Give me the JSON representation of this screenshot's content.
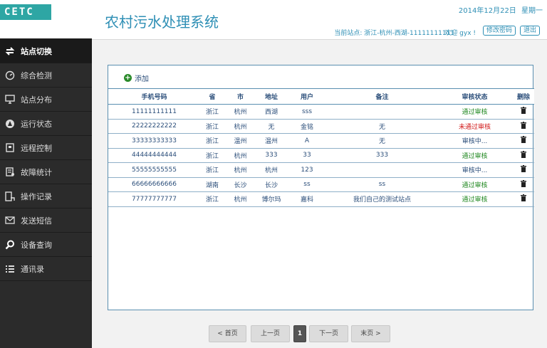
{
  "app": {
    "logo": "CETC",
    "title": "农村污水处理系统",
    "date": "2014年12月22日",
    "weekday": "星期一",
    "current_station": "当前站点: 浙江-杭州-西湖-11111111111",
    "welcome": "欢迎 gyx !",
    "change_password": "修改密码",
    "logout": "退出"
  },
  "sidebar": {
    "items": [
      {
        "label": "站点切换",
        "icon": "swap-icon"
      },
      {
        "label": "综合检测",
        "icon": "gauge-icon"
      },
      {
        "label": "站点分布",
        "icon": "monitor-icon"
      },
      {
        "label": "运行状态",
        "icon": "user-circle-icon"
      },
      {
        "label": "远程控制",
        "icon": "remote-icon"
      },
      {
        "label": "故障统计",
        "icon": "report-icon"
      },
      {
        "label": "操作记录",
        "icon": "record-icon"
      },
      {
        "label": "发送短信",
        "icon": "mail-icon"
      },
      {
        "label": "设备查询",
        "icon": "search-icon"
      },
      {
        "label": "通讯录",
        "icon": "list-icon"
      }
    ]
  },
  "toolbar": {
    "add_label": "添加"
  },
  "table": {
    "headers": [
      "手机号码",
      "省",
      "市",
      "地址",
      "用户",
      "备注",
      "审核状态",
      "删除"
    ],
    "rows": [
      {
        "phone": "11111111111",
        "province": "浙江",
        "city": "杭州",
        "address": "西湖",
        "user": "sss",
        "note": "",
        "status": "通过审核"
      },
      {
        "phone": "22222222222",
        "province": "浙江",
        "city": "杭州",
        "address": "无",
        "user": "金铭",
        "note": "无",
        "status": "未通过审核"
      },
      {
        "phone": "33333333333",
        "province": "浙江",
        "city": "温州",
        "address": "温州",
        "user": "A",
        "note": "无",
        "status": "审核中..."
      },
      {
        "phone": "44444444444",
        "province": "浙江",
        "city": "杭州",
        "address": "333",
        "user": "33",
        "note": "333",
        "status": "通过审核"
      },
      {
        "phone": "55555555555",
        "province": "浙江",
        "city": "杭州",
        "address": "杭州",
        "user": "123",
        "note": "",
        "status": "审核中..."
      },
      {
        "phone": "66666666666",
        "province": "湖南",
        "city": "长沙",
        "address": "长沙",
        "user": "ss",
        "note": "ss",
        "status": "通过审核"
      },
      {
        "phone": "77777777777",
        "province": "浙江",
        "city": "杭州",
        "address": "博尔玛",
        "user": "嘉科",
        "note": "我们自己的测试站点",
        "status": "通过审核"
      }
    ]
  },
  "pagination": {
    "first": "< 首页",
    "prev": "上一页",
    "current": "1",
    "next": "下一页",
    "last": "末页 >"
  },
  "colors": {
    "accent": "#2e8fb5",
    "sidebar_bg": "#2b2b2b",
    "status_pass": "#238a23",
    "status_fail": "#d11a1a",
    "logo_bg": "#2ea6a4"
  }
}
